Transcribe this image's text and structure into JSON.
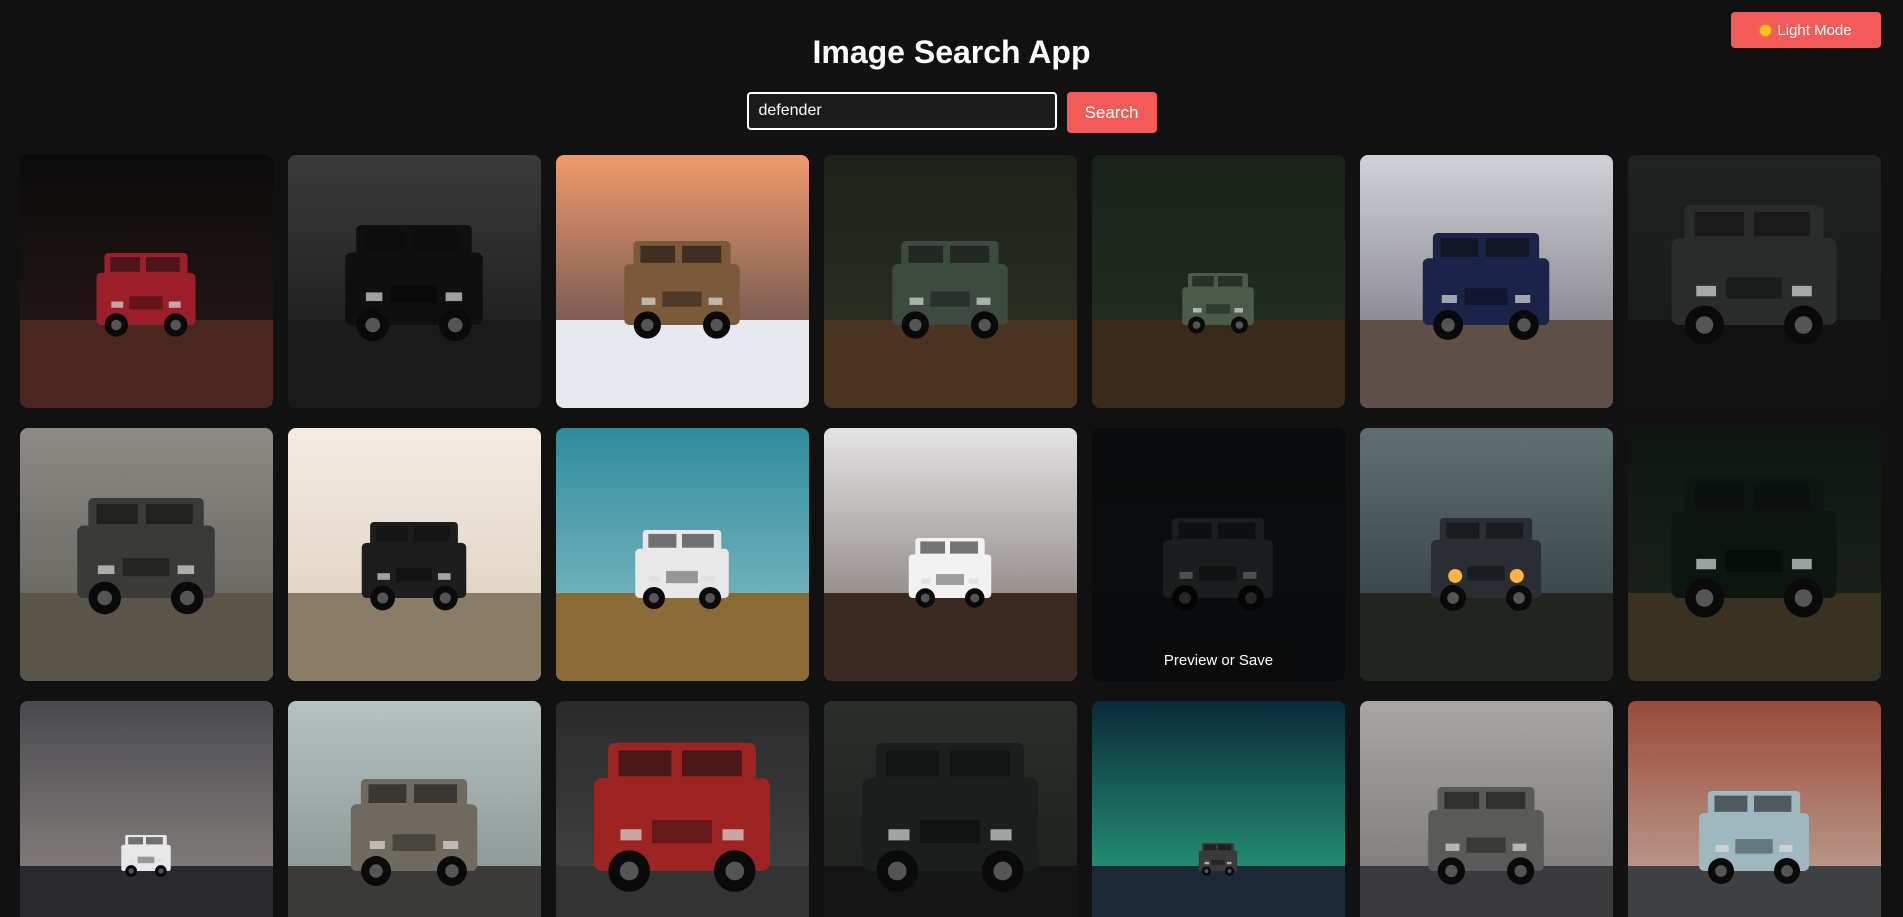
{
  "app": {
    "title": "Image Search App",
    "theme_toggle_label": "Light Mode",
    "theme_toggle_icon": "sun-icon"
  },
  "search": {
    "value": "defender",
    "button_label": "Search"
  },
  "hover_tooltip": "Preview or Save",
  "colors": {
    "accent": "#f45b58",
    "background": "#111111"
  },
  "results": [
    {
      "id": "defender-red-city-night",
      "sky": [
        "#0b0b0b",
        "#2a1a18"
      ],
      "ground": "#4a2620",
      "car": "#9b1f2a",
      "scale": 0.9
    },
    {
      "id": "defender-black-bw-building",
      "sky": [
        "#3a3a3a",
        "#151515"
      ],
      "ground": "#1a1a1a",
      "car": "#0f0f0f",
      "scale": 1.25
    },
    {
      "id": "defender-bronze-snow-sunset",
      "sky": [
        "#f09a6c",
        "#3d3e46"
      ],
      "ground": "#e8e9ee",
      "car": "#7a5a3a",
      "scale": 1.05
    },
    {
      "id": "defender-green-forest",
      "sky": [
        "#1c221a",
        "#2f3327"
      ],
      "ground": "#4a3420",
      "car": "#3e4a40",
      "scale": 1.05
    },
    {
      "id": "defender-green-forest-far",
      "sky": [
        "#182219",
        "#263022"
      ],
      "ground": "#3a2a1a",
      "car": "#4c5a4c",
      "scale": 0.65
    },
    {
      "id": "defender-blue-mountain",
      "sky": [
        "#d0d2d8",
        "#6b6a70"
      ],
      "ground": "#5e5048",
      "car": "#1b2348",
      "scale": 1.15
    },
    {
      "id": "defender-grille-dark",
      "sky": [
        "#202222",
        "#151616"
      ],
      "ground": "#121212",
      "car": "#2a2c2c",
      "scale": 1.5
    },
    {
      "id": "defender-grey-lake",
      "sky": [
        "#8d8a86",
        "#5a5a52"
      ],
      "ground": "#5b5448",
      "car": "#3a3a38",
      "scale": 1.25
    },
    {
      "id": "defender-black-dust-road",
      "sky": [
        "#f5ebe3",
        "#d9cbb8"
      ],
      "ground": "#8b7c66",
      "car": "#1d1d1d",
      "scale": 0.95
    },
    {
      "id": "defender-white-coast",
      "sky": [
        "#2f8c9c",
        "#8fc3c9"
      ],
      "ground": "#8a6b35",
      "car": "#e8e8e8",
      "scale": 0.85
    },
    {
      "id": "defender-white-river",
      "sky": [
        "#e4e4e4",
        "#6f6560"
      ],
      "ground": "#3a2a20",
      "car": "#f2f2f2",
      "scale": 0.75
    },
    {
      "id": "defender-dark-studio",
      "sky": [
        "#15191b",
        "#1b1f21"
      ],
      "ground": "#15191b",
      "car": "#3a3e40",
      "scale": 1.0,
      "dim": true
    },
    {
      "id": "defender-headlights-fog",
      "sky": [
        "#5f6f6f",
        "#2a3538"
      ],
      "ground": "#22251f",
      "car": "#2a2e33",
      "scale": 1.0,
      "lights": true
    },
    {
      "id": "defender-rear-door-green",
      "sky": [
        "#0e1410",
        "#1f261c"
      ],
      "ground": "#3a3220",
      "car": "#0d1510",
      "scale": 1.5
    },
    {
      "id": "defender-road-storm",
      "sky": [
        "#4a4a4e",
        "#9c9490"
      ],
      "ground": "#2a2a2e",
      "car": "#e8e8e8",
      "scale": 0.45
    },
    {
      "id": "defender-grey-rooftent",
      "sky": [
        "#b7c2c0",
        "#7c8684"
      ],
      "ground": "#3a3a38",
      "car": "#6e6a60",
      "scale": 1.15
    },
    {
      "id": "defender-red-door-street",
      "sky": [
        "#2a2a2a",
        "#4a4a4a"
      ],
      "ground": "#333333",
      "car": "#9e2424",
      "scale": 1.6
    },
    {
      "id": "defender-black-bonnet",
      "sky": [
        "#2a2e2a",
        "#1a1c1a"
      ],
      "ground": "#151515",
      "car": "#1a1e1c",
      "scale": 1.6
    },
    {
      "id": "defender-aurora",
      "sky": [
        "#0b2a3a",
        "#2fbf8f"
      ],
      "ground": "#1b2a36",
      "car": "#3a3a3a",
      "scale": 0.35
    },
    {
      "id": "defender-grey-city-cloudy",
      "sky": [
        "#a8a6a4",
        "#6e6c6a"
      ],
      "ground": "#3a3a3c",
      "car": "#5a5a58",
      "scale": 1.05
    },
    {
      "id": "defender-teal-street",
      "sky": [
        "#9a4a3a",
        "#c8bcb0"
      ],
      "ground": "#3e4042",
      "car": "#9fb8c0",
      "scale": 1.0
    }
  ]
}
